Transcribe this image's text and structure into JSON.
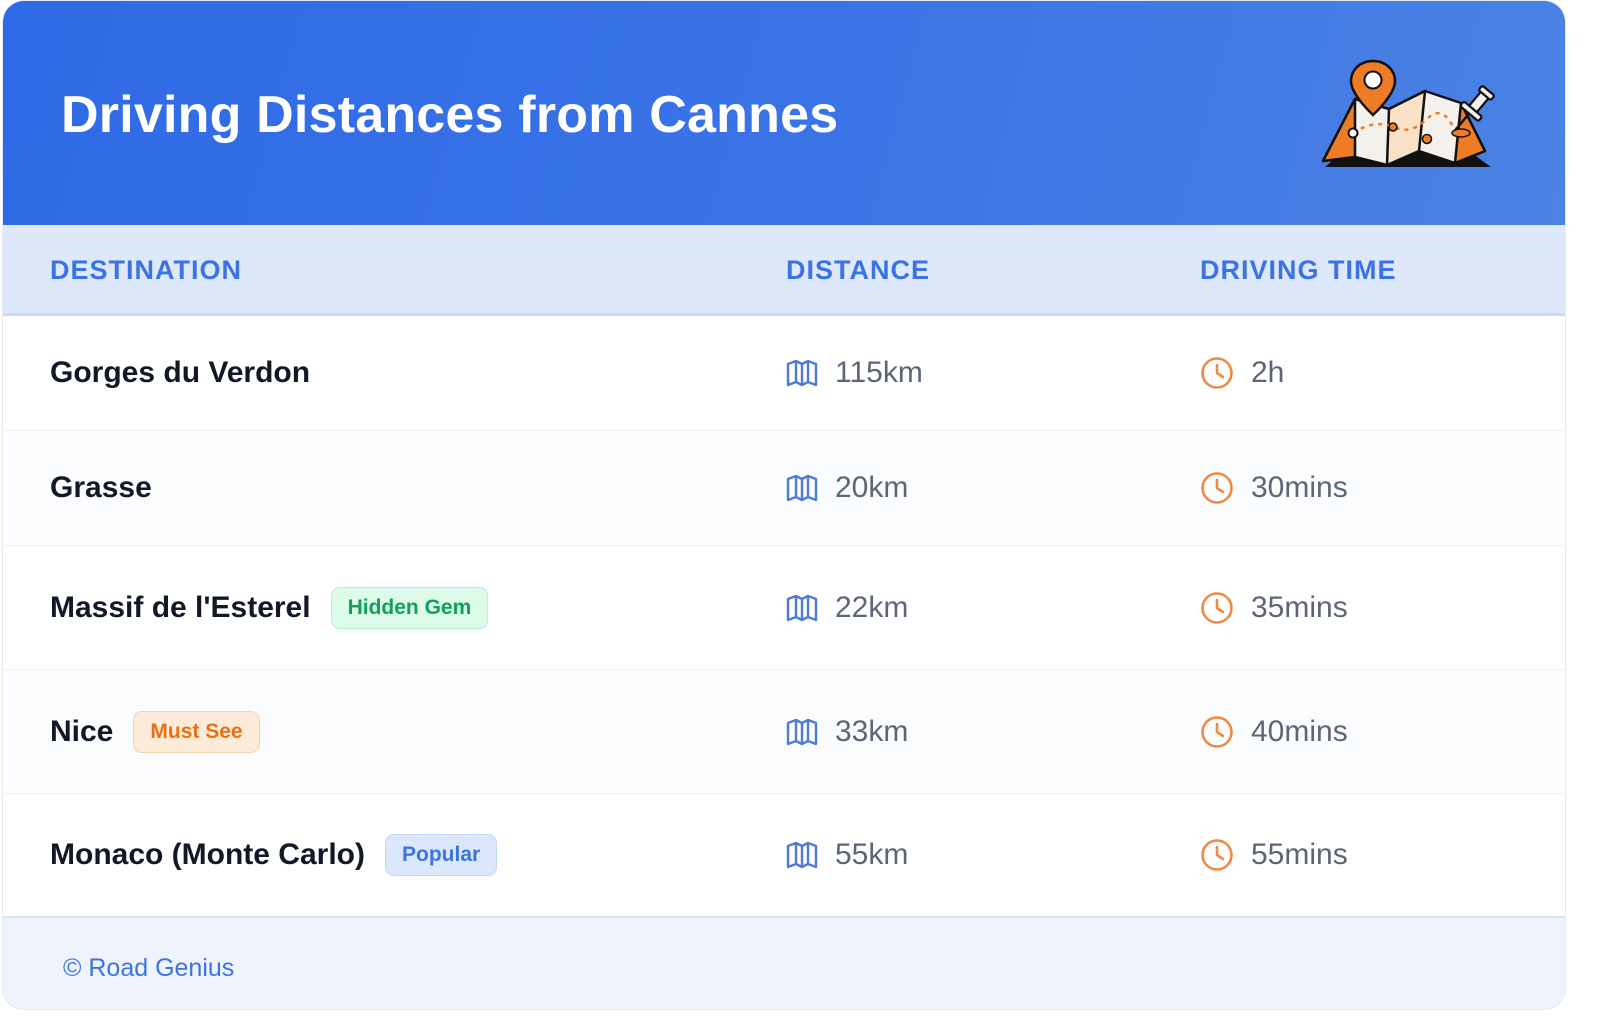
{
  "header": {
    "title": "Driving Distances from Cannes"
  },
  "table": {
    "columns": [
      "DESTINATION",
      "DISTANCE",
      "DRIVING TIME"
    ],
    "rows": [
      {
        "destination": "Gorges du Verdon",
        "badge": null,
        "distance": "115km",
        "time": "2h"
      },
      {
        "destination": "Grasse",
        "badge": null,
        "distance": "20km",
        "time": "30mins"
      },
      {
        "destination": "Massif de l'Esterel",
        "badge": "Hidden Gem",
        "distance": "22km",
        "time": "35mins"
      },
      {
        "destination": "Nice",
        "badge": "Must See",
        "distance": "33km",
        "time": "40mins"
      },
      {
        "destination": "Monaco (Monte Carlo)",
        "badge": "Popular",
        "distance": "55km",
        "time": "55mins"
      }
    ]
  },
  "footer": {
    "copyright": "© Road Genius"
  },
  "icons": {
    "distance": "map-icon",
    "time": "clock-icon",
    "header": "map-pin-illustration"
  },
  "colors": {
    "header": "#3068e6",
    "accent": "#3b74e2",
    "icon_distance": "#4f7bd6",
    "icon_time": "#ef8a45",
    "badge_hidden_gem": "#12a15a",
    "badge_must_see": "#ec6f12",
    "badge_popular": "#3b74e2"
  }
}
